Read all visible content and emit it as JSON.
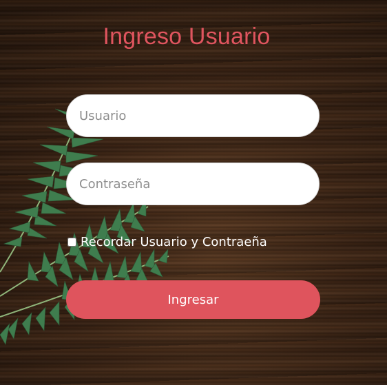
{
  "login": {
    "title": "Ingreso Usuario",
    "username_placeholder": "Usuario",
    "username_value": "",
    "password_placeholder": "Contraseña",
    "password_value": "",
    "remember_label": "Recordar Usuario y Contraeña",
    "remember_checked": false,
    "submit_label": "Ingresar"
  },
  "colors": {
    "accent": "#df545d",
    "title": "#e0555f",
    "field_background": "#ffffff",
    "text_on_dark": "#ffffff"
  },
  "icons": [
    "fern-leaf-decoration"
  ]
}
